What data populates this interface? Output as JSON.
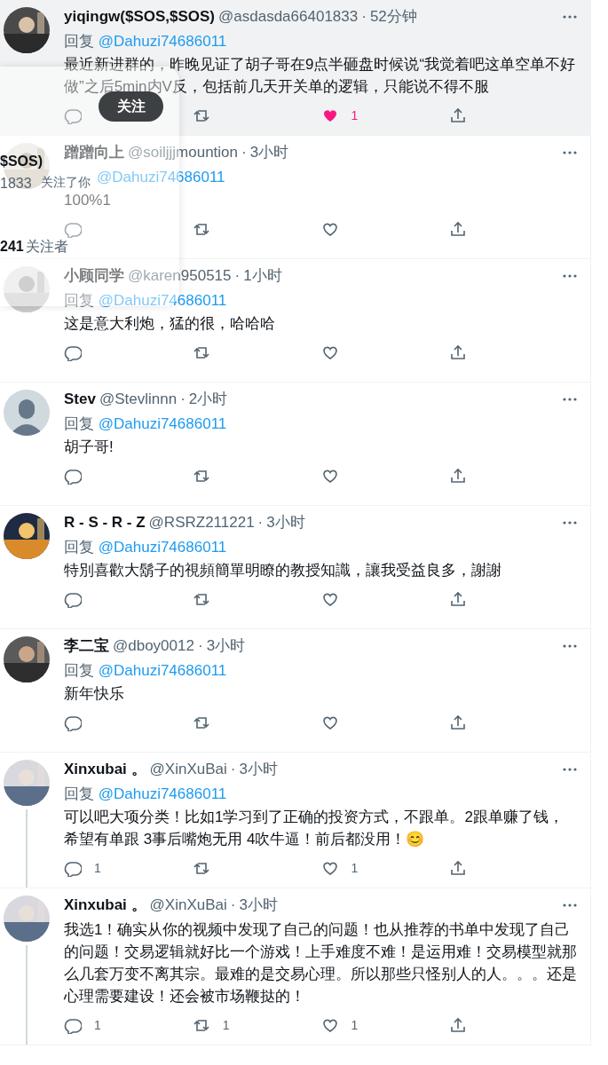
{
  "tweets": [
    {
      "name": "yiqingw($SOS,$SOS)",
      "handle": "@asdasda66401833",
      "separator": "·",
      "time": "52分钟",
      "reply_label": "回复",
      "reply_to": "@Dahuzi74686011",
      "text": "最近新进群的，昨晚见证了胡子哥在9点半砸盘时候说“我觉着吧这单空单不好做”之后5min内V反，包括前几天开关单的逻辑，只能说不得不服",
      "highlighted": true,
      "thread_line": false,
      "liked": true,
      "likes": "1"
    },
    {
      "name": "蹭蹭向上",
      "handle": "@soiljjjmountion",
      "separator": "·",
      "time": "3小时",
      "reply_to": "@Dahuzi74686011",
      "text": "100%1",
      "highlighted": false,
      "thread_line": false,
      "liked": false
    },
    {
      "name": "小顾同学",
      "handle": "@karen950515",
      "separator": "·",
      "time": "1小时",
      "reply_label": "回复",
      "reply_to": "@Dahuzi74686011",
      "text": "这是意大利炮，猛的很，哈哈哈",
      "highlighted": false,
      "thread_line": false,
      "liked": false
    },
    {
      "name": "Stev",
      "handle": "@Stevlinnn",
      "separator": "·",
      "time": "2小时",
      "reply_label": "回复",
      "reply_to": "@Dahuzi74686011",
      "text": "胡子哥!",
      "avatar": {
        "kind": "default"
      },
      "highlighted": false,
      "thread_line": false,
      "liked": false
    },
    {
      "name": "R - S - R - Z",
      "handle": "@RSRZ211221",
      "separator": "·",
      "time": "3小时",
      "reply_label": "回复",
      "reply_to": "@Dahuzi74686011",
      "text": "特別喜歡大鬍子的視頻簡單明瞭的教授知識，讓我受益良多，謝謝",
      "highlighted": false,
      "thread_line": false,
      "liked": false
    },
    {
      "name": "李二宝",
      "handle": "@dboy0012",
      "separator": "·",
      "time": "3小时",
      "reply_label": "回复",
      "reply_to": "@Dahuzi74686011",
      "text": "新年快乐",
      "highlighted": false,
      "thread_line": false,
      "liked": false
    },
    {
      "name": "Xinxubai 。",
      "handle": "@XinXuBai",
      "separator": "·",
      "time": "3小时",
      "reply_label": "回复",
      "reply_to": "@Dahuzi74686011",
      "text": "可以吧大项分类！比如1学习到了正确的投资方式，不跟单。2跟单赚了钱，希望有单跟 3事后嘴炮无用 4吹牛逼！前后都没用！😊",
      "highlighted": false,
      "thread_line": true,
      "liked": false,
      "replies": "1",
      "likes": "1"
    },
    {
      "name": "Xinxubai 。",
      "handle": "@XinXuBai",
      "separator": "·",
      "time": "3小时",
      "text": "我选1！确实从你的视频中发现了自己的问题！也从推荐的书单中发现了自己的问题！交易逻辑就好比一个游戏！上手难度不难！是运用难！交易模型就那么几套万变不离其宗。最难的是交易心理。所以那些只怪别人的人。。。还是心理需要建设！还会被市场鞭挞的！",
      "highlighted": false,
      "thread_line": true,
      "liked": false,
      "replies": "1",
      "retweets": "1",
      "likes": "1"
    }
  ],
  "hover_card": {
    "follow_button": "关注",
    "name_fragment": "$SOS)",
    "handle_fragment": "1833",
    "follows_you": "关注了你",
    "followers_count": "241",
    "followers_label": "关注者"
  }
}
